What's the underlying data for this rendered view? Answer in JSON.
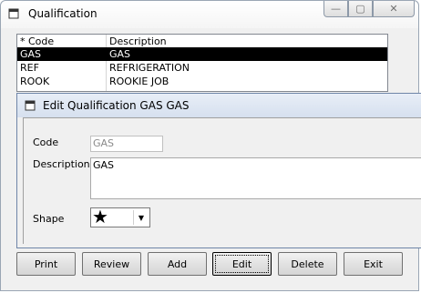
{
  "outer_window": {
    "title": "Qualification",
    "controls": {
      "minimize": "—",
      "maximize": "▢",
      "close": "✕"
    }
  },
  "list": {
    "columns": [
      "* Code",
      "Description"
    ],
    "rows": [
      {
        "code": "GAS",
        "description": "GAS",
        "selected": true
      },
      {
        "code": "REF",
        "description": "REFRIGERATION",
        "selected": false
      },
      {
        "code": "ROOK",
        "description": "ROOKIE JOB",
        "selected": false
      }
    ]
  },
  "dialog": {
    "title": "Edit Qualification GAS GAS",
    "code_label": "Code",
    "code_value": "GAS",
    "description_label": "Description",
    "description_value": "GAS",
    "shape_label": "Shape",
    "shape_value": "★",
    "shape_dropdown_glyph": "▼"
  },
  "buttons": {
    "print": "Print",
    "review": "Review",
    "add": "Add",
    "edit": "Edit",
    "delete": "Delete",
    "exit": "Exit"
  }
}
